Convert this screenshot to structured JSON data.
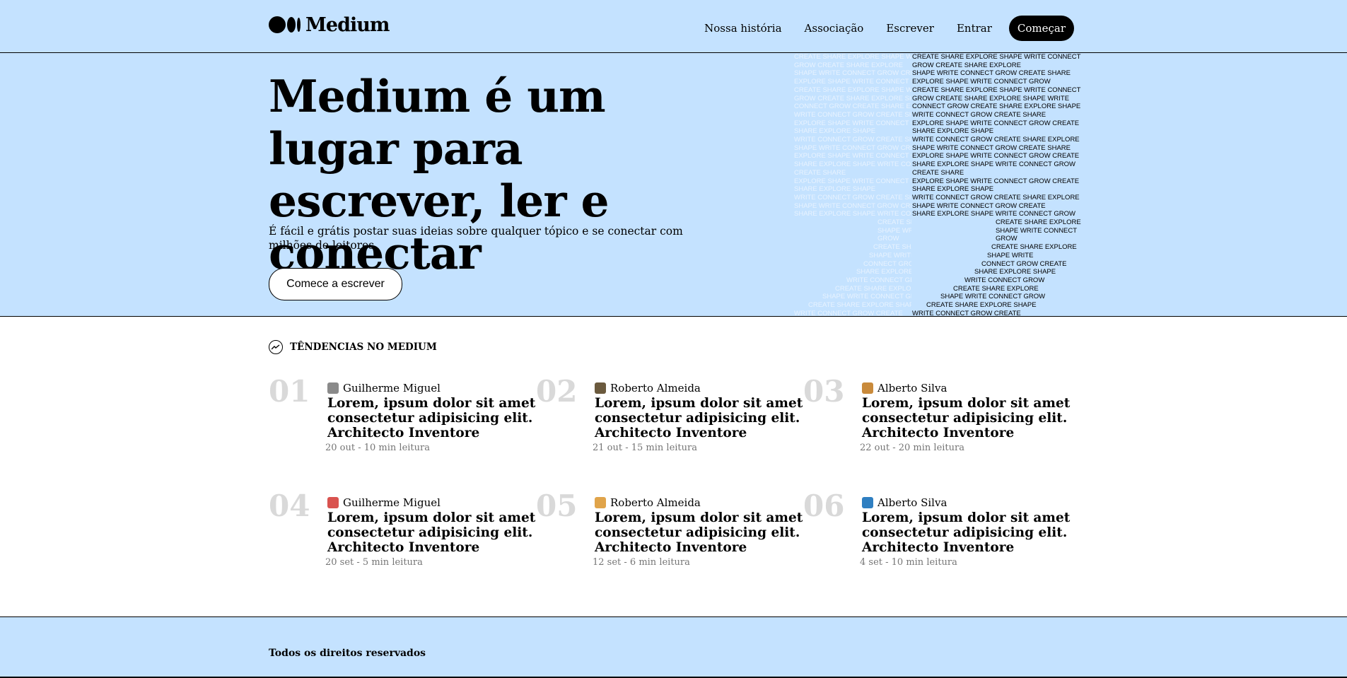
{
  "header": {
    "logo_text": "Medium",
    "nav": [
      "Nossa história",
      "Associação",
      "Escrever",
      "Entrar"
    ],
    "cta": "Começar"
  },
  "hero": {
    "title": "Medium é um lugar para escrever, ler e conectar",
    "subtitle": "É fácil e grátis postar suas ideias sobre qualquer tópico e se conectar com milhões de leitores.",
    "button": "Comece a escrever",
    "art_lines": [
      [
        "CREATE SHARE EXPLORE SHAPE WRITE CONNECT",
        "CREATE SHARE EXPLORE SHAPE WRITE CONNECT"
      ],
      [
        "GROW CREATE SHARE EXPLORE",
        "GROW CREATE SHARE EXPLORE"
      ],
      [
        "SHAPE WRITE CONNECT GROW CREATE SHARE",
        "SHAPE WRITE CONNECT GROW CREATE SHARE"
      ],
      [
        "EXPLORE SHAPE WRITE CONNECT GROW",
        "EXPLORE SHAPE WRITE CONNECT GROW"
      ],
      [
        "CREATE SHARE EXPLORE SHAPE WRITE CONNECT",
        "CREATE SHARE EXPLORE SHAPE WRITE CONNECT"
      ],
      [
        "GROW CREATE SHARE EXPLORE SHAPE WRITE",
        "GROW CREATE SHARE EXPLORE SHAPE WRITE"
      ],
      [
        "CONNECT GROW CREATE SHARE EXPLORE SHAPE",
        "CONNECT GROW CREATE SHARE EXPLORE SHAPE"
      ],
      [
        "WRITE CONNECT GROW CREATE SHARE",
        "WRITE CONNECT GROW CREATE SHARE"
      ],
      [
        "EXPLORE SHAPE WRITE CONNECT GROW CREATE",
        "EXPLORE SHAPE WRITE CONNECT GROW CREATE"
      ],
      [
        "SHARE EXPLORE SHAPE",
        "SHARE EXPLORE SHAPE"
      ],
      [
        "WRITE CONNECT GROW CREATE SHARE EXPLORE",
        "WRITE CONNECT GROW CREATE SHARE EXPLORE"
      ],
      [
        "SHAPE WRITE CONNECT GROW CREATE SHARE",
        "SHAPE WRITE CONNECT GROW CREATE SHARE"
      ],
      [
        "EXPLORE SHAPE WRITE CONNECT GROW CREATE",
        "EXPLORE SHAPE WRITE CONNECT GROW CREATE"
      ],
      [
        "SHARE EXPLORE SHAPE WRITE CONNECT GROW",
        "SHARE EXPLORE SHAPE WRITE CONNECT GROW"
      ],
      [
        "CREATE SHARE",
        "CREATE SHARE"
      ],
      [
        "EXPLORE SHAPE WRITE CONNECT GROW CREATE",
        "EXPLORE SHAPE WRITE CONNECT GROW CREATE"
      ],
      [
        "SHARE EXPLORE SHAPE",
        "SHARE EXPLORE SHAPE"
      ],
      [
        "WRITE CONNECT GROW CREATE SHARE EXPLORE",
        "WRITE CONNECT GROW CREATE SHARE EXPLORE"
      ],
      [
        "SHAPE WRITE CONNECT GROW CREATE",
        "SHAPE WRITE CONNECT GROW CREATE"
      ],
      [
        "SHARE EXPLORE SHAPE WRITE CONNECT GROW",
        "SHARE EXPLORE SHAPE WRITE CONNECT GROW"
      ]
    ],
    "art_tail": [
      "CREATE SHARE EXPLORE",
      "SHAPE WRITE CONNECT",
      "GROW",
      "CREATE SHARE EXPLORE",
      "SHAPE WRITE",
      "CONNECT GROW CREATE",
      "SHARE EXPLORE SHAPE",
      "WRITE CONNECT GROW",
      "CREATE SHARE EXPLORE",
      "SHAPE WRITE CONNECT GROW",
      "CREATE SHARE EXPLORE SHAPE",
      "WRITE CONNECT GROW CREATE"
    ]
  },
  "trending": {
    "heading": "TÊNDENCIAS NO MEDIUM",
    "items": [
      {
        "num": "01",
        "author": "Guilherme Miguel",
        "title": "Lorem, ipsum dolor sit amet consectetur adipisicing elit. Architecto Inventore",
        "meta": "20 out - 10 min leitura",
        "avatar_color": "#8a8a8a"
      },
      {
        "num": "02",
        "author": "Roberto Almeida",
        "title": "Lorem, ipsum dolor sit amet consectetur adipisicing elit. Architecto Inventore",
        "meta": "21 out - 15 min leitura",
        "avatar_color": "#6b5a3e"
      },
      {
        "num": "03",
        "author": "Alberto Silva",
        "title": "Lorem, ipsum dolor sit amet consectetur adipisicing elit. Architecto Inventore",
        "meta": "22 out - 20 min leitura",
        "avatar_color": "#c98a3b"
      },
      {
        "num": "04",
        "author": "Guilherme Miguel",
        "title": "Lorem, ipsum dolor sit amet consectetur adipisicing elit. Architecto Inventore",
        "meta": "20 set - 5 min leitura",
        "avatar_color": "#d9534f"
      },
      {
        "num": "05",
        "author": "Roberto Almeida",
        "title": "Lorem, ipsum dolor sit amet consectetur adipisicing elit. Architecto Inventore",
        "meta": "12 set - 6 min leitura",
        "avatar_color": "#e0a44a"
      },
      {
        "num": "06",
        "author": "Alberto Silva",
        "title": "Lorem, ipsum dolor sit amet consectetur adipisicing elit. Architecto Inventore",
        "meta": "4 set - 10 min leitura",
        "avatar_color": "#2f7fc1"
      }
    ]
  },
  "footer": {
    "rights": "Todos os direitos reservados"
  },
  "colors": {
    "brand_bg": "#c4e2ff",
    "number_gray": "#d9d9d9",
    "meta_gray": "#757575"
  }
}
